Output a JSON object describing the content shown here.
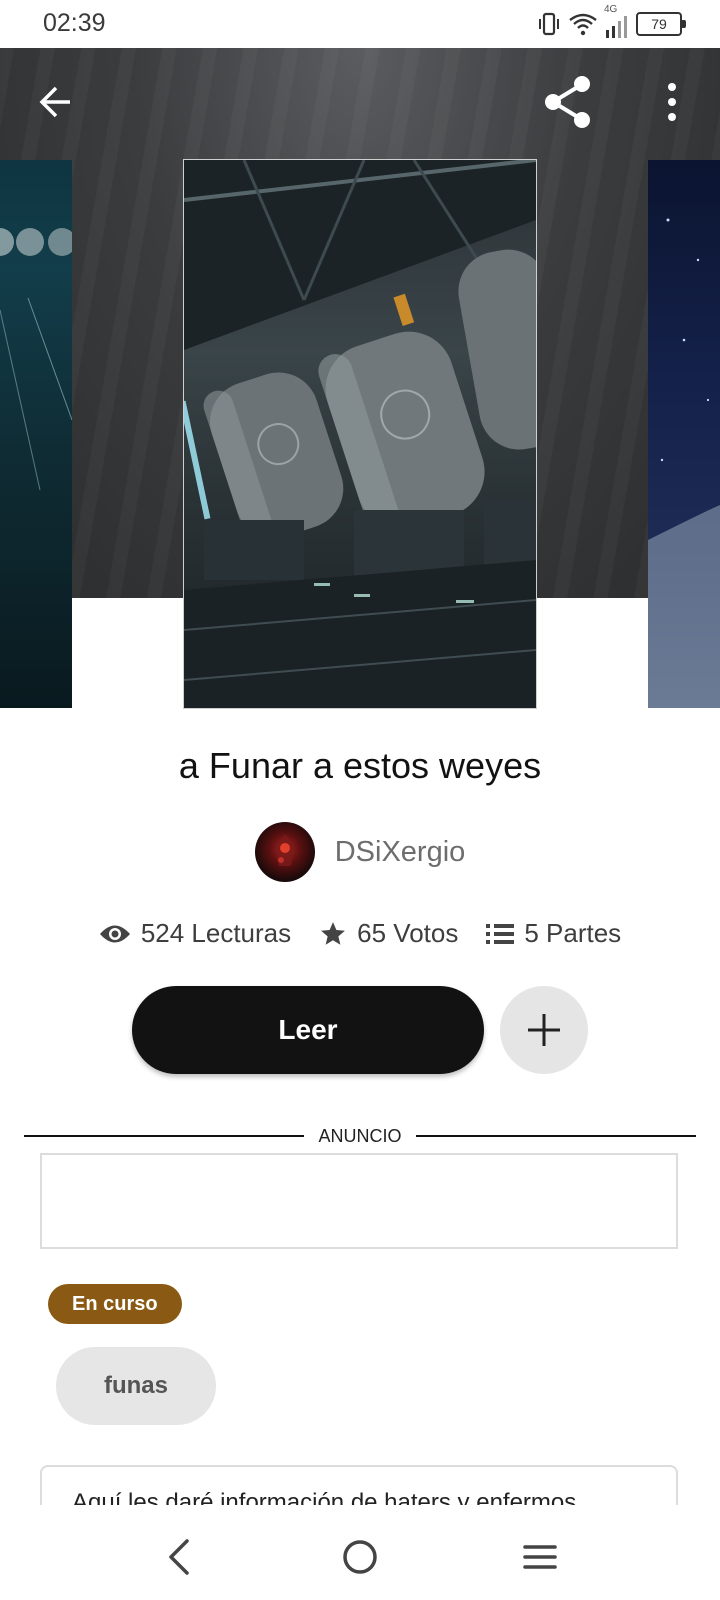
{
  "status_bar": {
    "time": "02:39",
    "network": "4G",
    "battery": "79",
    "icons": [
      "vibrate-icon",
      "wifi-icon",
      "signal-icon",
      "battery-icon"
    ]
  },
  "toolbar": {
    "back_icon": "arrow-left-icon",
    "share_icon": "share-icon",
    "more_icon": "more-vertical-icon"
  },
  "story": {
    "title": "a Funar a estos weyes",
    "author": "DSiXergio",
    "stats": {
      "reads": "524 Lecturas",
      "votes": "65 Votos",
      "parts": "5 Partes"
    },
    "read_button": "Leer",
    "status": "En curso",
    "tags": [
      "funas"
    ],
    "description": "Aquí les daré información de haters y enfermos"
  },
  "ad": {
    "label": "ANUNCIO"
  },
  "colors": {
    "primary_button": "#121212",
    "status_badge": "#8a5a14",
    "chip": "#e6e6e6"
  },
  "navigation": {
    "icons": [
      "back-icon",
      "home-icon",
      "menu-icon"
    ]
  }
}
